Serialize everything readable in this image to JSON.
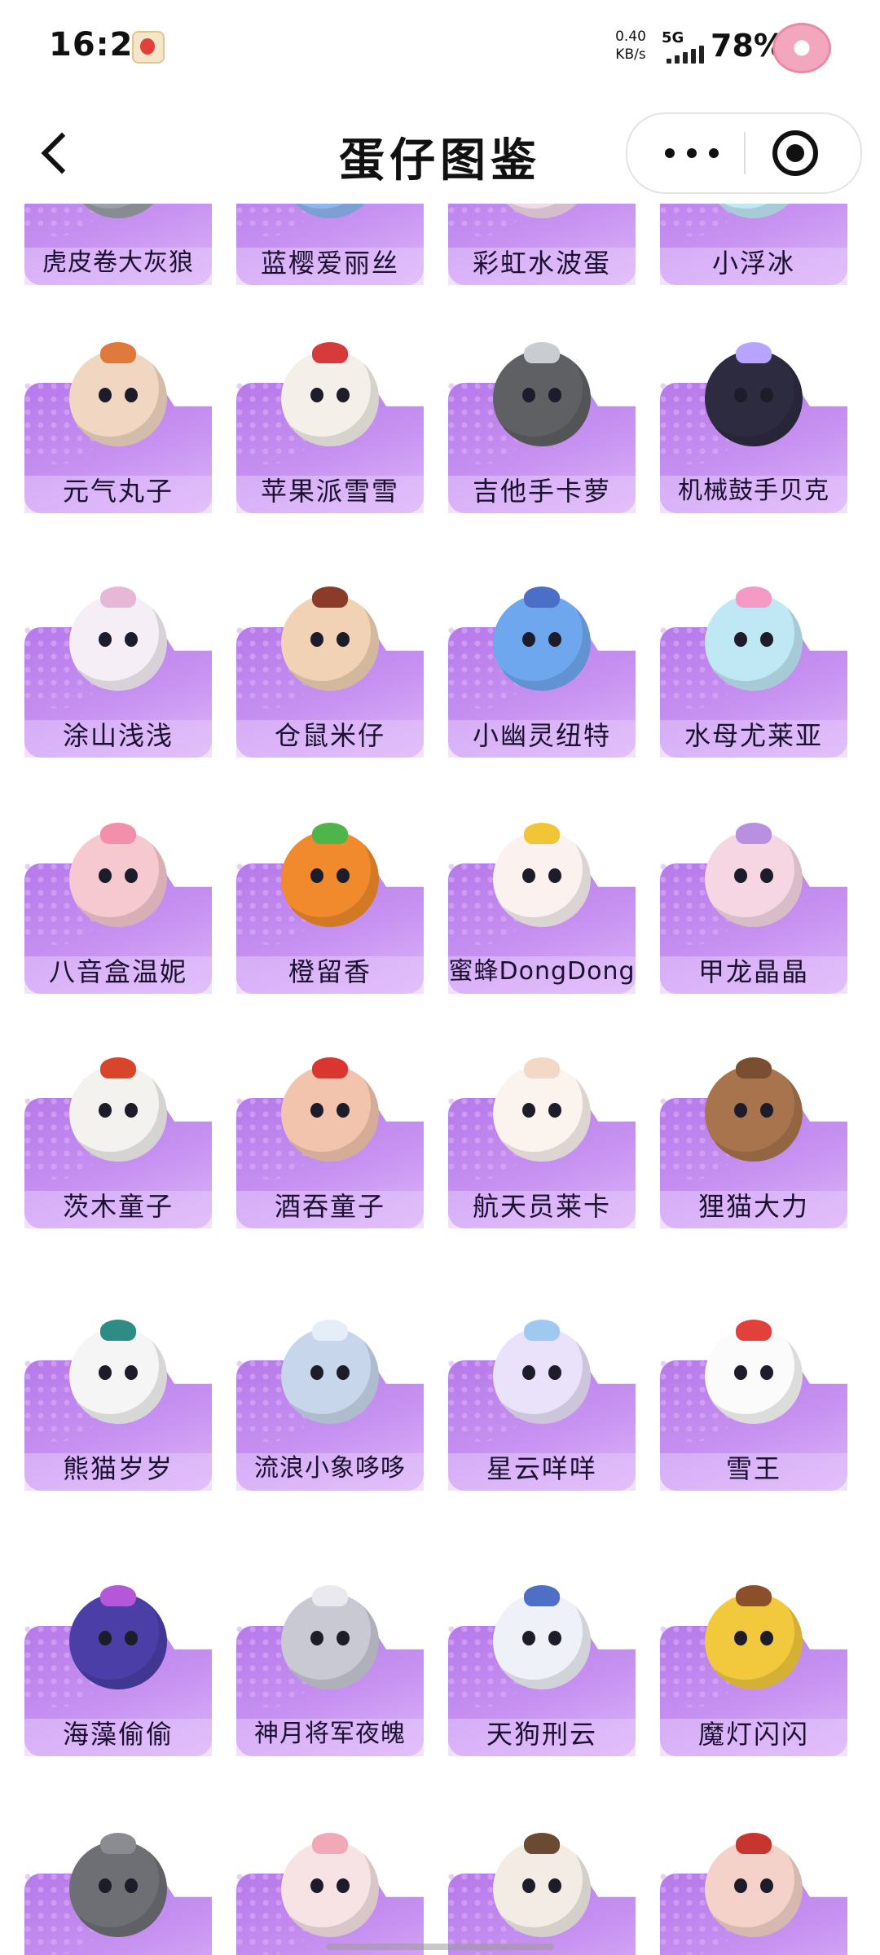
{
  "status_bar": {
    "time": "16:20",
    "network_speed_value": "0.40",
    "network_speed_unit": "KB/s",
    "network_type": "5G",
    "battery": "78%"
  },
  "title_bar": {
    "title": "蛋仔图鉴"
  },
  "colors": {
    "card_gradient_start": "#b779ea",
    "card_gradient_end": "#ddb6f8",
    "label_text": "#1b1030"
  },
  "rows": [
    {
      "cards": [
        {
          "name": "虎皮卷大灰狼",
          "body": "#9aa0a8"
        },
        {
          "name": "蓝樱爱丽丝",
          "body": "#8fb6f0"
        },
        {
          "name": "彩虹水波蛋",
          "body": "#f3d9e8"
        },
        {
          "name": "小浮冰",
          "body": "#bfe7f5"
        }
      ]
    },
    {
      "cards": [
        {
          "name": "元气丸子",
          "body": "#f1d7c1",
          "acc": "#e07a3c"
        },
        {
          "name": "苹果派雪雪",
          "body": "#f4efe9",
          "acc": "#d63a3a"
        },
        {
          "name": "吉他手卡萝",
          "body": "#5f6063",
          "acc": "#c9ccd1"
        },
        {
          "name": "机械鼓手贝克",
          "body": "#2d2b3f",
          "acc": "#b7a4ff"
        }
      ]
    },
    {
      "cards": [
        {
          "name": "涂山浅浅",
          "body": "#f6eef6",
          "acc": "#e7b7d8"
        },
        {
          "name": "仓鼠米仔",
          "body": "#f1d2b4",
          "acc": "#8c3b2b"
        },
        {
          "name": "小幽灵纽特",
          "body": "#6fa7ef",
          "acc": "#4b6fc6"
        },
        {
          "name": "水母尤莱亚",
          "body": "#bfe8f4",
          "acc": "#f59ac4"
        }
      ]
    },
    {
      "cards": [
        {
          "name": "八音盒温妮",
          "body": "#f6c8cf",
          "acc": "#f28fab"
        },
        {
          "name": "橙留香",
          "body": "#f08a2c",
          "acc": "#4fb54a"
        },
        {
          "name": "蜜蜂DongDong",
          "body": "#fbf2ef",
          "acc": "#f2c537"
        },
        {
          "name": "甲龙晶晶",
          "body": "#f6d6e3",
          "acc": "#b98fe0"
        }
      ]
    },
    {
      "cards": [
        {
          "name": "茨木童子",
          "body": "#f4f2ef",
          "acc": "#d8452b"
        },
        {
          "name": "酒吞童子",
          "body": "#f2c4ad",
          "acc": "#d8362f"
        },
        {
          "name": "航天员莱卡",
          "body": "#fbf3ee",
          "acc": "#f2d9c7"
        },
        {
          "name": "狸猫大力",
          "body": "#a8744d",
          "acc": "#7a4f31"
        }
      ]
    },
    {
      "cards": [
        {
          "name": "熊猫岁岁",
          "body": "#f5f5f5",
          "acc": "#2e8d82"
        },
        {
          "name": "流浪小象哆哆",
          "body": "#c7d6ea",
          "acc": "#e5eef8"
        },
        {
          "name": "星云咩咩",
          "body": "#eae1fb",
          "acc": "#9fc9f0"
        },
        {
          "name": "雪王",
          "body": "#fbfbfb",
          "acc": "#e2403a"
        }
      ]
    },
    {
      "cards": [
        {
          "name": "海藻偷偷",
          "body": "#4b3ea6",
          "acc": "#b457d8"
        },
        {
          "name": "神月将军夜魄",
          "body": "#c8c9d3",
          "acc": "#e9e9ef"
        },
        {
          "name": "天狗刑云",
          "body": "#eef1f8",
          "acc": "#4d6fc6"
        },
        {
          "name": "魔灯闪闪",
          "body": "#f2c93d",
          "acc": "#8b4f2a"
        }
      ]
    },
    {
      "cards": [
        {
          "name": "",
          "body": "#6d6f75",
          "acc": "#8a8c92"
        },
        {
          "name": "",
          "body": "#f7e2e4",
          "acc": "#f1a9b8"
        },
        {
          "name": "",
          "body": "#f2ece4",
          "acc": "#6a4a33"
        },
        {
          "name": "",
          "body": "#f4d2c9",
          "acc": "#c7352e"
        }
      ]
    }
  ]
}
